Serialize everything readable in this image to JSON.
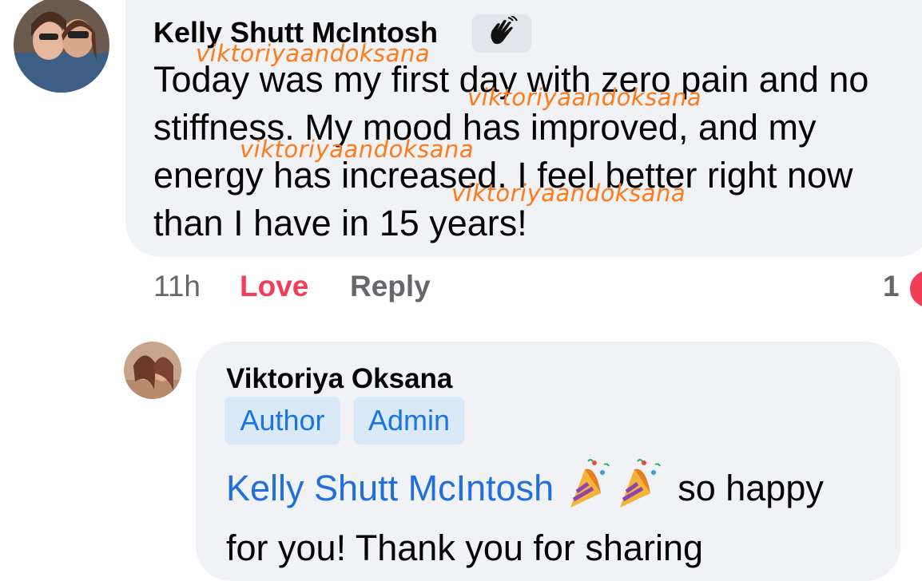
{
  "comment": {
    "author": "Kelly Shutt McIntosh",
    "badge_icon": "wave-hand-icon",
    "text": "Today was my first day with zero pain and no stiffness. My mood has improved, and my energy has increased. I feel better right now than I have in 15 years!",
    "timestamp": "11h",
    "reaction_label": "Love",
    "reply_label": "Reply",
    "reaction_count": "1"
  },
  "watermarks": [
    "viktoriyaandoksana",
    "viktoriyaandoksana",
    "viktoriyaandoksana",
    "viktoriyaandoksana"
  ],
  "reply": {
    "author": "Viktoriya Oksana",
    "badges": [
      "Author",
      "Admin"
    ],
    "mention": "Kelly Shutt McIntosh",
    "emoji": "party-popper-icon",
    "text_after_emoji": " so happy",
    "text_line2": "for you! Thank you for sharing"
  },
  "colors": {
    "bubble": "#f0f2f5",
    "love": "#f33e58",
    "link": "#216fdb",
    "watermark": "#ff7a1a"
  }
}
